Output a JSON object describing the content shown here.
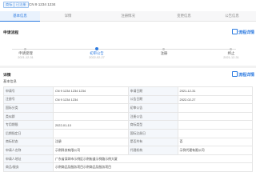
{
  "header": {
    "tag_type": "商标",
    "tag_status": "已注册",
    "title": "CN 9 1234 1234"
  },
  "tabs": [
    {
      "label": "基本信息",
      "active": true
    },
    {
      "label": "详情",
      "active": false
    },
    {
      "label": "注册情况",
      "active": false
    },
    {
      "label": "变更信息",
      "active": false
    },
    {
      "label": "公告信息",
      "active": false
    }
  ],
  "progress": {
    "title": "申请流程",
    "action": "流程详情",
    "steps": [
      {
        "label": "申请受理",
        "date": "2021-12-31",
        "active": false
      },
      {
        "label": "初审公告",
        "date": "2022-02-27",
        "active": true
      },
      {
        "label": "注册",
        "date": "",
        "active": false
      },
      {
        "label": "终止",
        "date": "2021-12-31",
        "active": false
      }
    ]
  },
  "details": {
    "title": "详情",
    "action": "流程详情",
    "subtitle": "基本信息",
    "rows": [
      {
        "l1": "申请号",
        "v1": "CN 9 1234 1234 1234",
        "l2": "申请日期",
        "v2": "2021-12-31"
      },
      {
        "l1": "注册号",
        "v1": "CN 9 1234 1234",
        "l2": "公告日期",
        "v2": "2022-02-27"
      },
      {
        "l1": "国际分类",
        "v1": "",
        "l2": "初审公告",
        "v2": ""
      },
      {
        "l1": "类似群",
        "v1": "",
        "l2": "注册公告",
        "v2": ""
      },
      {
        "l1": "专用期限",
        "v1": "2022-01-10",
        "l2": "商标类型",
        "v2": ""
      },
      {
        "l1": "后期指定日",
        "v1": "",
        "l2": "国际注册日",
        "v2": ""
      },
      {
        "l1": "商标状态",
        "v1": "注册",
        "l2": "是否共有",
        "v2": "否"
      },
      {
        "l1": "申请人名称",
        "v1": "示例科技有限公司",
        "l2": "代理机构",
        "v2": "示例代理有限公司"
      },
      {
        "l1": "申请人地址",
        "v1": "广东省深圳市示例区示例街道示例路示例大厦",
        "l2": "",
        "v2": ""
      },
      {
        "l1": "商品/服务",
        "v1": "示例商品及服务项目示例商品及服务项目",
        "l2": "",
        "v2": ""
      }
    ]
  }
}
